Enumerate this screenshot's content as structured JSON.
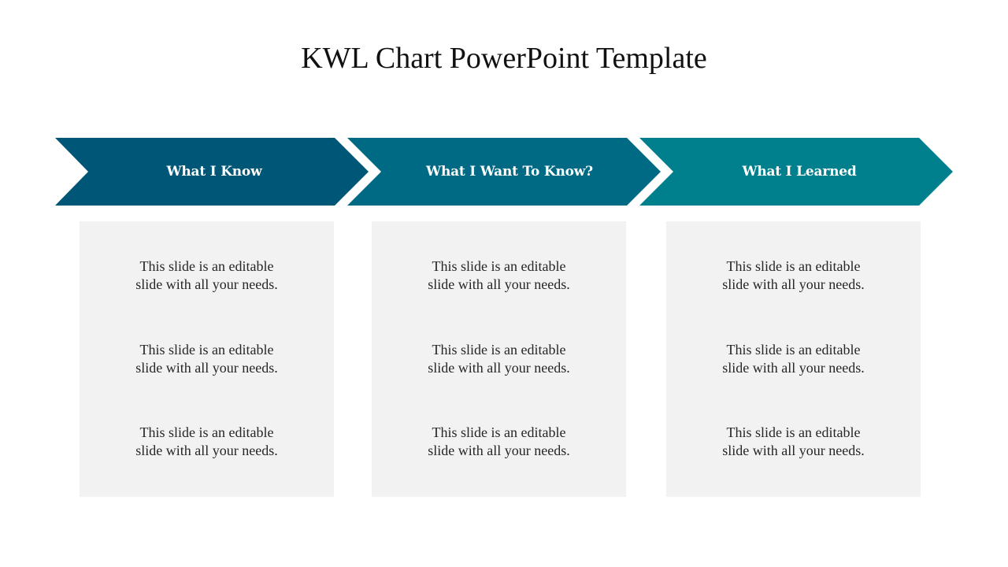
{
  "title": "KWL Chart PowerPoint Template",
  "colors": {
    "step1": "#005677",
    "step2": "#006a85",
    "step3": "#00808c",
    "box_bg": "#f2f2f2"
  },
  "steps": [
    {
      "label": "What I Know",
      "items": [
        "This slide is an editable slide with all your needs.",
        "This slide is an editable slide with all your needs.",
        "This slide is an editable slide with all your needs."
      ]
    },
    {
      "label": "What I Want To Know?",
      "items": [
        "This slide is an editable slide with all your needs.",
        "This slide is an editable slide with all your needs.",
        "This slide is an editable slide with all your needs."
      ]
    },
    {
      "label": "What I Learned",
      "items": [
        "This slide is an editable slide with all your needs.",
        "This slide is an editable slide with all your needs.",
        "This slide is an editable slide with all your needs."
      ]
    }
  ]
}
